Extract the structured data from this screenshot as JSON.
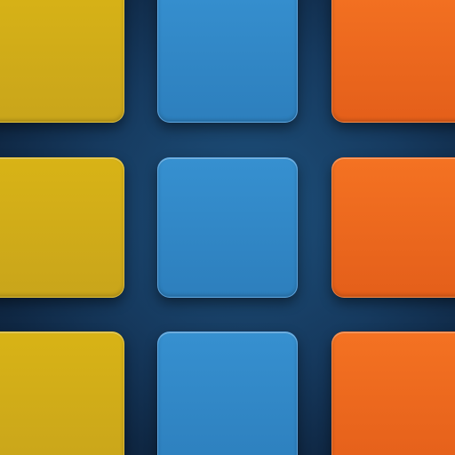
{
  "board": {
    "rows": 3,
    "columns": 3,
    "background_color": "#163a5f",
    "tiles": [
      [
        "yellow",
        "blue",
        "orange"
      ],
      [
        "yellow",
        "blue",
        "orange"
      ],
      [
        "yellow",
        "blue",
        "orange"
      ]
    ]
  },
  "colors": {
    "yellow": "#d2ad18",
    "blue": "#3189c8",
    "orange": "#ee6a1f"
  }
}
